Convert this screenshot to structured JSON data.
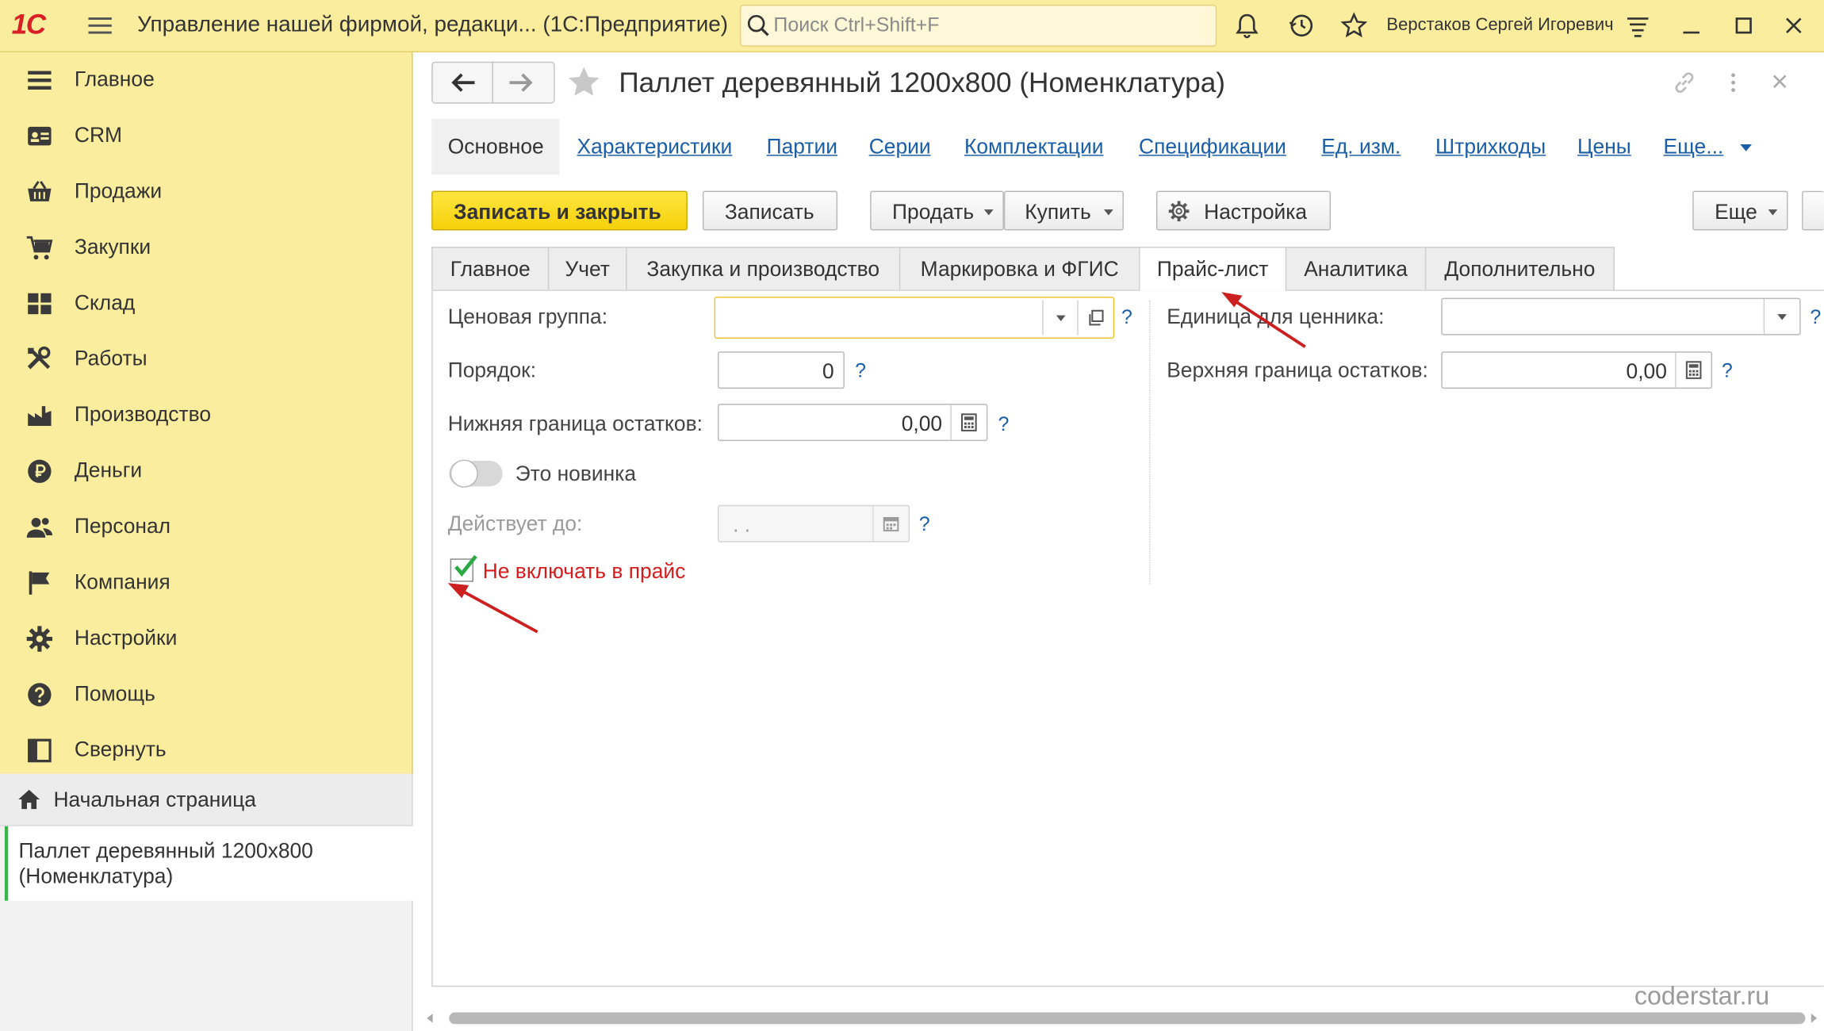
{
  "app": {
    "logo": "1С",
    "title": "Управление нашей фирмой, редакци...  (1С:Предприятие)",
    "search_placeholder": "Поиск Ctrl+Shift+F",
    "user": "Верстаков Сергей Игоревич",
    "icons": [
      "bell-icon",
      "history-icon",
      "star-icon",
      "settings-lines-icon",
      "minimize-icon",
      "maximize-icon",
      "close-icon"
    ]
  },
  "sidebar": {
    "items": [
      {
        "label": "Главное",
        "icon": "menu-lines-icon"
      },
      {
        "label": "CRM",
        "icon": "contact-card-icon"
      },
      {
        "label": "Продажи",
        "icon": "basket-icon"
      },
      {
        "label": "Закупки",
        "icon": "cart-icon"
      },
      {
        "label": "Склад",
        "icon": "grid-blocks-icon"
      },
      {
        "label": "Работы",
        "icon": "tools-icon"
      },
      {
        "label": "Производство",
        "icon": "factory-icon"
      },
      {
        "label": "Деньги",
        "icon": "ruble-icon"
      },
      {
        "label": "Персонал",
        "icon": "people-icon"
      },
      {
        "label": "Компания",
        "icon": "flag-icon"
      },
      {
        "label": "Настройки",
        "icon": "gear-icon"
      },
      {
        "label": "Помощь",
        "icon": "help-icon"
      },
      {
        "label": "Свернуть",
        "icon": "collapse-panel-icon"
      }
    ],
    "home": "Начальная страница",
    "open_doc": "Паллет деревянный 1200х800 (Номенклатура)"
  },
  "form": {
    "title": "Паллет деревянный 1200х800 (Номенклатура)",
    "subnav": {
      "main": "Основное",
      "links": [
        "Характеристики",
        "Партии",
        "Серии",
        "Комплектации",
        "Спецификации",
        "Ед. изм.",
        "Штрихкоды",
        "Цены",
        "Еще..."
      ]
    },
    "toolbar": {
      "save_close": "Записать и закрыть",
      "save": "Записать",
      "sell": "Продать",
      "buy": "Купить",
      "settings": "Настройка",
      "more": "Еще"
    },
    "tabs": [
      "Главное",
      "Учет",
      "Закупка и производство",
      "Маркировка и ФГИС",
      "Прайс-лист",
      "Аналитика",
      "Дополнительно"
    ],
    "active_tab": "Прайс-лист",
    "fields": {
      "price_group_label": "Ценовая группа:",
      "price_group_value": "",
      "order_label": "Порядок:",
      "order_value": "0",
      "lower_bound_label": "Нижняя граница остатков:",
      "lower_bound_value": "0,00",
      "novelty_label": "Это новинка",
      "novelty_on": false,
      "valid_until_label": "Действует до:",
      "valid_until_value": " .  .",
      "exclude_label": "Не включать в прайс",
      "exclude_checked": true,
      "unit_label": "Единица для ценника:",
      "unit_value": "",
      "upper_bound_label": "Верхняя граница остатков:",
      "upper_bound_value": "0,00",
      "help": "?"
    }
  },
  "watermark": "coderstar.ru",
  "colors": {
    "accent_yellow": "#fbed9e",
    "primary_button": "#f6d10a",
    "link": "#1a5ea8",
    "annotation_red": "#cc1f1f",
    "check_green": "#2aa842"
  }
}
